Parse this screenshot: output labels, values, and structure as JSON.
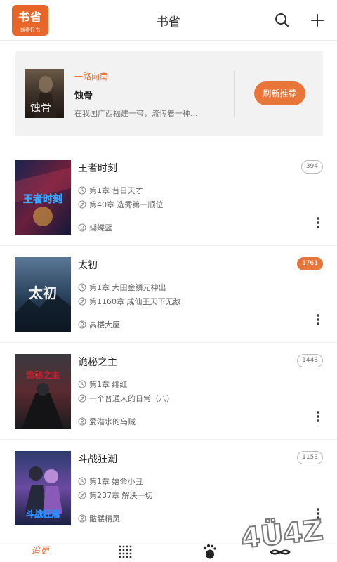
{
  "header": {
    "logo_main": "书省",
    "logo_sub": "就看好书",
    "title": "书省"
  },
  "recommend": {
    "category": "一路向南",
    "book_title": "蚀骨",
    "cover_text": "蚀骨",
    "description": "在我国广西福建一带，流传着一种...",
    "refresh_label": "刷新推荐"
  },
  "books": [
    {
      "title": "王者时刻",
      "chapter_first": "第1章 昔日天才",
      "chapter_latest": "第40章 选秀第一顺位",
      "author": "蝴蝶蓝",
      "count": "394",
      "cover_text": "王者时刻",
      "highlight": false
    },
    {
      "title": "太初",
      "chapter_first": "第1章 大田金鳞元神出",
      "chapter_latest": "第1160章 成仙王天下无敌",
      "author": "高楼大厦",
      "count": "1761",
      "cover_text": "太初",
      "highlight": true
    },
    {
      "title": "诡秘之主",
      "chapter_first": "第1章 绯红",
      "chapter_latest": "一个普通人的日常（八）",
      "author": "爱潜水的乌贼",
      "count": "1448",
      "cover_text": "诡秘之主",
      "highlight": false
    },
    {
      "title": "斗战狂潮",
      "chapter_first": "第1章 嬉命小丑",
      "chapter_latest": "第237章 解决一切",
      "author": "骷髅精灵",
      "count": "1153",
      "cover_text": "斗战狂潮",
      "highlight": false
    }
  ],
  "nav": {
    "tab_follow": "追更"
  },
  "watermark": "4Ü4Z",
  "colors": {
    "accent": "#e8763a",
    "logo_bg": "#e8652a"
  }
}
